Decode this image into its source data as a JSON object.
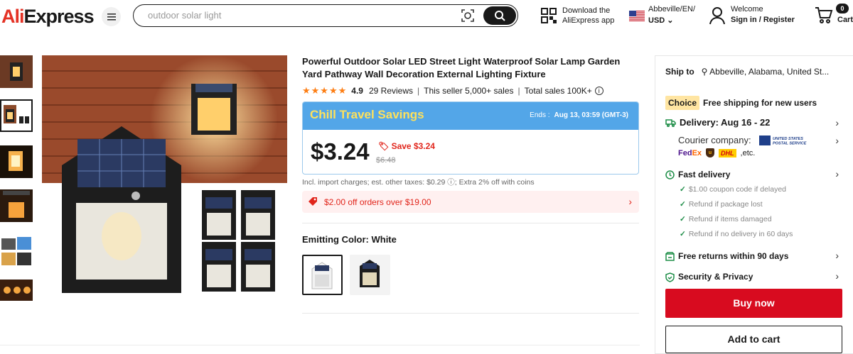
{
  "header": {
    "logo": "AliExpress",
    "search": {
      "placeholder": "outdoor solar light"
    },
    "download": {
      "line1": "Download the",
      "line2": "AliExpress app"
    },
    "locale": {
      "line1": "Abbeville/EN/",
      "line2": "USD"
    },
    "account": {
      "line1": "Welcome",
      "line2": "Sign in / Register"
    },
    "cart": {
      "count": "0",
      "label": "Cart"
    }
  },
  "product": {
    "title": "Powerful Outdoor Solar LED Street Light Waterproof Solar Lamp Garden Yard Pathway Wall Decoration External Lighting Fixture",
    "stars": "★★★★★",
    "rating": "4.9",
    "reviews": "29 Reviews",
    "seller": "This seller 5,000+ sales",
    "total_sales": "Total sales 100K+",
    "deal": {
      "name": "Chill Travel Savings",
      "ends_label": "Ends :",
      "ends_value": "Aug 13, 03:59 (GMT-3)"
    },
    "price": "$3.24",
    "save": "Save $3.24",
    "original_price": "$6.48",
    "taxes": "Incl. import charges; est. other taxes: $0.29",
    "extra": "; Extra 2% off with coins",
    "coupon": "$2.00 off orders over $19.00",
    "color_label": "Emitting Color: White"
  },
  "panel": {
    "ship_label": "Ship to",
    "ship_location": "Abbeville, Alabama, United St...",
    "choice_badge": "Choice",
    "choice_text": "Free shipping for new users",
    "delivery": "Delivery: Aug 16 - 22",
    "courier": "Courier company:",
    "usps": "UNITED STATES POSTAL SERVICE",
    "etc": ",etc.",
    "fast_delivery": "Fast delivery",
    "guarantees": [
      "$1.00 coupon code if delayed",
      "Refund if package lost",
      "Refund if items damaged",
      "Refund if no delivery in 60 days"
    ],
    "free_returns": "Free returns within 90 days",
    "security": "Security & Privacy",
    "buy_now": "Buy now",
    "add_to_cart": "Add to cart"
  },
  "colors": {
    "brand_red": "#e43225",
    "buy_red": "#d80b1f",
    "deal_blue": "#53a6e8",
    "deal_yellow": "#ffe15a",
    "star_orange": "#fd7e14"
  }
}
